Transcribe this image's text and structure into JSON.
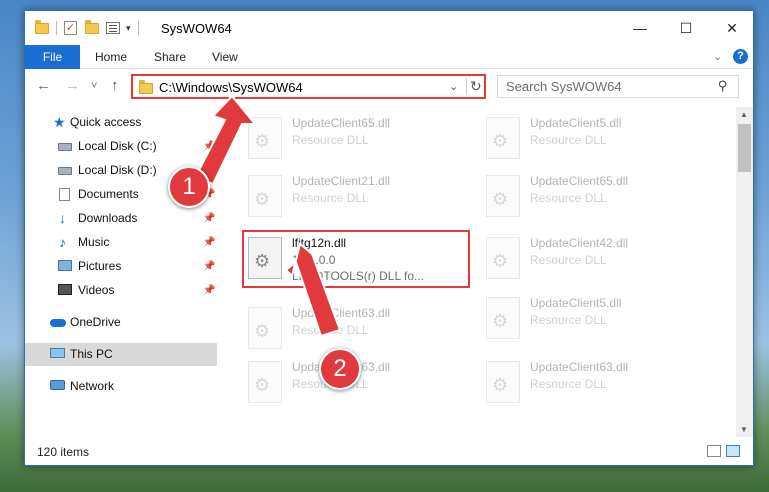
{
  "window": {
    "title": "SysWOW64",
    "controls": {
      "minimize": "—",
      "maximize": "☐",
      "close": "✕"
    },
    "qat_arrow": "▾"
  },
  "ribbon": {
    "tabs": [
      "File",
      "Home",
      "Share",
      "View"
    ],
    "collapse_glyph": "⌄",
    "help_glyph": "?"
  },
  "nav": {
    "back": "←",
    "forward": "→",
    "recent": "˅",
    "up": "↑",
    "address": "C:\\Windows\\SysWOW64",
    "address_dropdown": "⌄",
    "refresh": "↻",
    "search_placeholder": "Search SysWOW64",
    "search_icon": "⚲"
  },
  "sidebar": {
    "items": [
      {
        "label": "Quick access",
        "icon": "star-icon",
        "pinned": false
      },
      {
        "label": "Local Disk (C:)",
        "icon": "disk-icon",
        "pinned": true
      },
      {
        "label": "Local Disk (D:)",
        "icon": "disk-icon",
        "pinned": true
      },
      {
        "label": "Documents",
        "icon": "documents-icon",
        "pinned": true
      },
      {
        "label": "Downloads",
        "icon": "downloads-icon",
        "pinned": true
      },
      {
        "label": "Music",
        "icon": "music-icon",
        "pinned": true
      },
      {
        "label": "Pictures",
        "icon": "pictures-icon",
        "pinned": true
      },
      {
        "label": "Videos",
        "icon": "videos-icon",
        "pinned": true
      },
      {
        "label": "OneDrive",
        "icon": "onedrive-icon",
        "pinned": false
      },
      {
        "label": "This PC",
        "icon": "this-pc-icon",
        "pinned": false,
        "selected": true
      },
      {
        "label": "Network",
        "icon": "network-icon",
        "pinned": false
      }
    ],
    "pin_glyph": "📌"
  },
  "files": {
    "left": [
      {
        "name": "UpdateClient65.dll",
        "type": "Resource DLL"
      },
      {
        "name": "UpdateClient21.dll",
        "type": "Resource DLL"
      },
      {
        "name": "lfitg12n.dll",
        "version": "12.1.0.0",
        "description": "LEADTOOLS(r) DLL fo...",
        "highlighted": true
      },
      {
        "name": "UpdateClient63.dll",
        "type": "Resource DLL"
      },
      {
        "name": "UpdateClient63.dll",
        "type": "Resource DLL"
      }
    ],
    "right": [
      {
        "name": "UpdateClient5.dll",
        "type": "Resource DLL"
      },
      {
        "name": "UpdateClient65.dll",
        "type": "Resource DLL"
      },
      {
        "name": "UpdateClient42.dll",
        "type": "Resource DLL"
      },
      {
        "name": "UpdateClient5.dll",
        "type": "Resource DLL"
      },
      {
        "name": "UpdateClient63.dll",
        "type": "Resource DLL"
      }
    ]
  },
  "status": {
    "item_count": "120 items",
    "scroll_up": "▲",
    "scroll_down": "▼"
  },
  "annotations": {
    "step1": "1",
    "step2": "2",
    "color": "#e0393e"
  }
}
